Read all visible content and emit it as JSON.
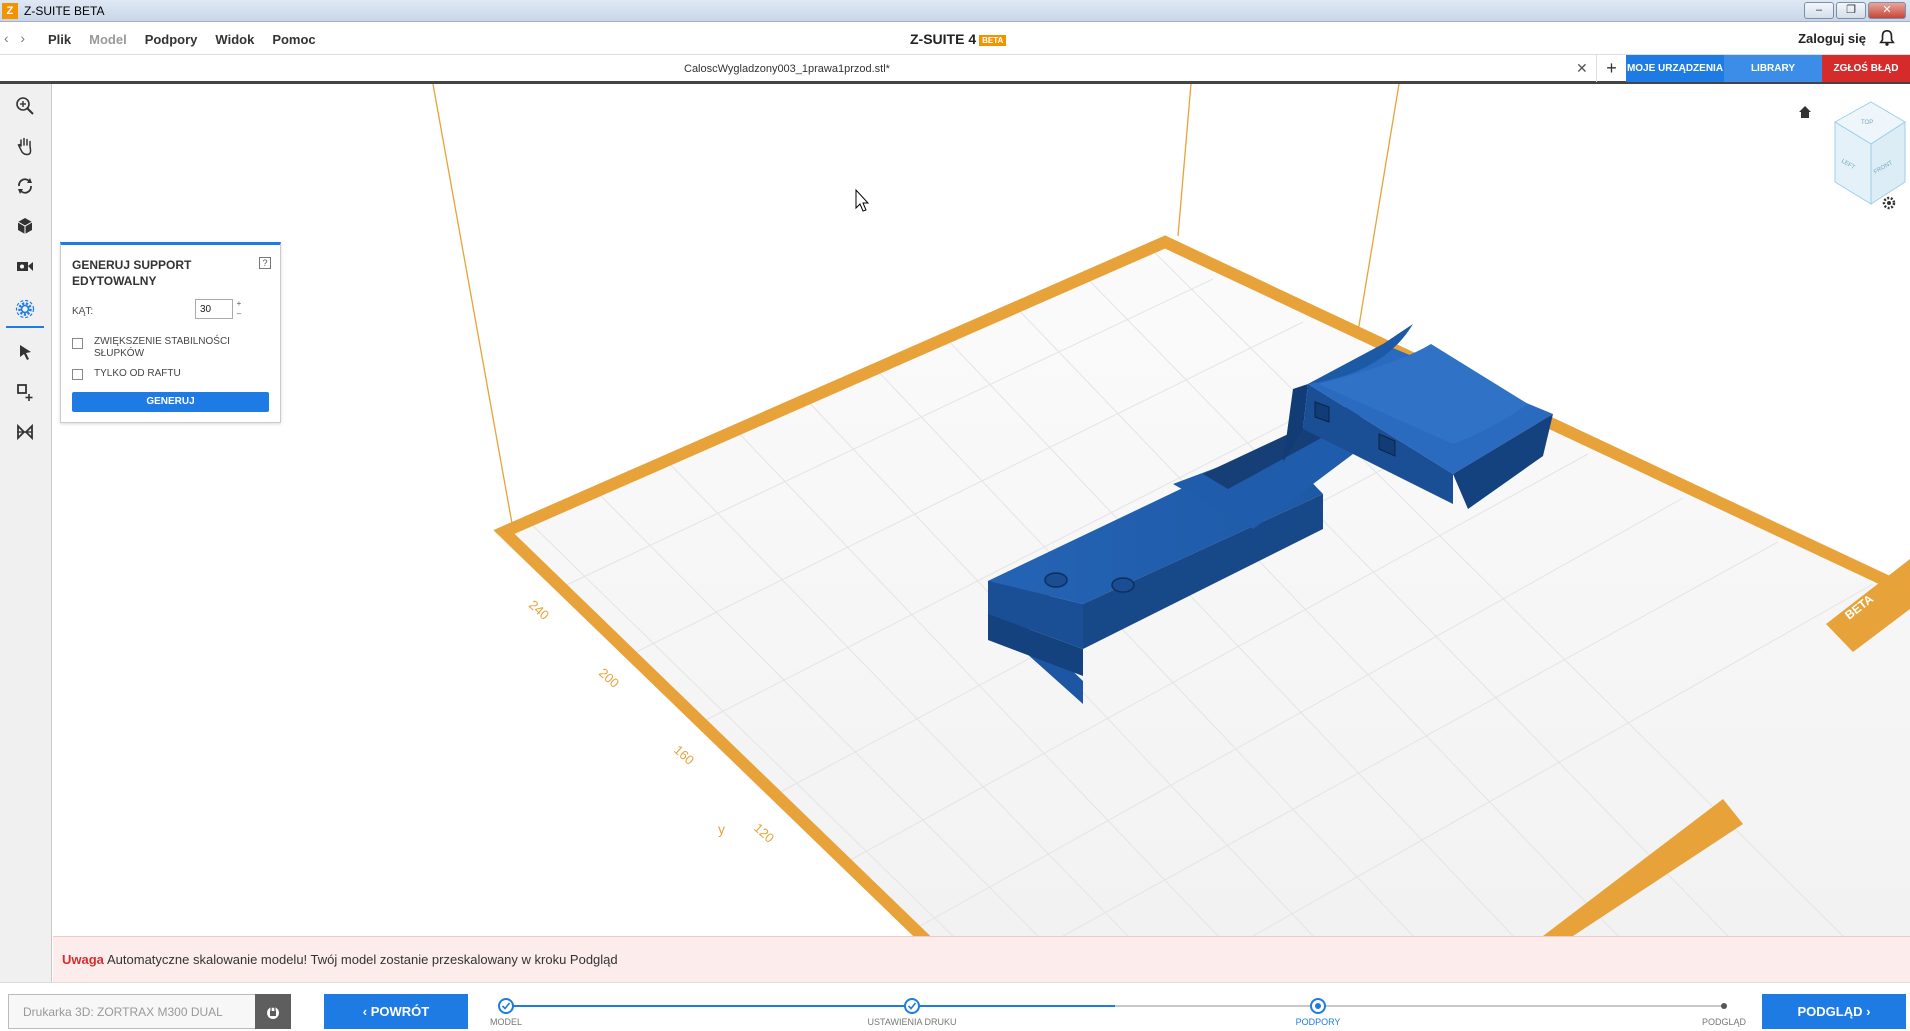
{
  "window": {
    "title": "Z-SUITE BETA",
    "logo": "Z"
  },
  "menu": {
    "items": [
      "Plik",
      "Model",
      "Podpory",
      "Widok",
      "Pomoc"
    ],
    "brand": "Z-SUITE 4",
    "brand_badge": "BETA",
    "login": "Zaloguj się"
  },
  "tabs": {
    "file": "CaloscWygladzony003_1prawa1przod.stl*",
    "my_devices": "MOJE URZĄDZENIA",
    "library": "LIBRARY",
    "report_bug": "ZGŁOŚ BŁĄD"
  },
  "colors": {
    "accent": "#1e7be3",
    "bed": "#e8a23a",
    "model": "#1f5fa8",
    "error": "#d62b2b"
  },
  "panel": {
    "title": "GENERUJ SUPPORT EDYTOWALNY",
    "help": "?",
    "angle_label": "KĄT:",
    "angle_value": "30",
    "option1": "ZWIĘKSZENIE STABILNOŚCI SŁUPKÓW",
    "option2": "TYLKO OD RAFTU",
    "generate": "GENERUJ"
  },
  "viewport": {
    "axis_label": "y",
    "ticks": [
      "240",
      "200",
      "160",
      "120"
    ],
    "corner_badge": "BETA"
  },
  "warning": {
    "label": "Uwaga",
    "text": "Automatyczne skalowanie modelu! Twój model zostanie przeskalowany w kroku Podgląd"
  },
  "bottom": {
    "printer_placeholder": "Drukarka 3D: ZORTRAX M300 DUAL",
    "back": "POWRÓT",
    "next": "PODGLĄD",
    "steps": [
      "MODEL",
      "USTAWIENIA DRUKU",
      "PODPORY",
      "PODGLĄD"
    ],
    "progress_fraction": 0.5
  }
}
